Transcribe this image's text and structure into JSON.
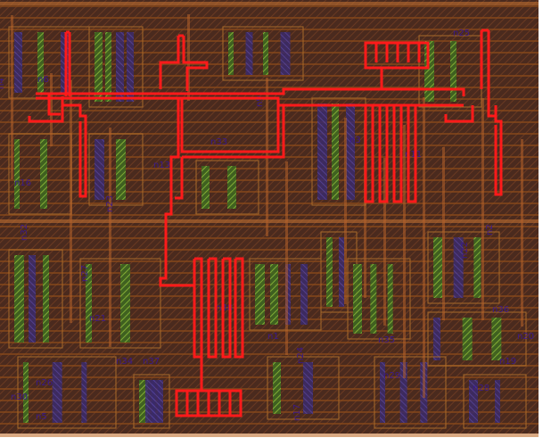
{
  "view": {
    "kind": "ic-layout-viewer",
    "highlighted_net_color": "#ff1a1a",
    "substrate_color": "#4a2a1e",
    "layer_colors": {
      "metal1": "#7a3c14",
      "metal2": "#c8661c",
      "poly": "#d03030",
      "diffusion": "#3c8a28",
      "active": "#9ad23c",
      "via": "#3a2aa0"
    }
  },
  "net_labels": [
    {
      "id": "n6",
      "text": "n6"
    },
    {
      "id": "n33",
      "text": "n33"
    },
    {
      "id": "n4",
      "text": "n4"
    },
    {
      "id": "n13",
      "text": "n13"
    },
    {
      "id": "n9",
      "text": "n9"
    },
    {
      "id": "n23",
      "text": "n23"
    },
    {
      "id": "n3",
      "text": "n3"
    },
    {
      "id": "n32",
      "text": "n32"
    },
    {
      "id": "n25",
      "text": "n25"
    },
    {
      "id": "n2",
      "text": "n2"
    },
    {
      "id": "n27",
      "text": "n27"
    },
    {
      "id": "n21",
      "text": "n21"
    },
    {
      "id": "n22",
      "text": "n22"
    },
    {
      "id": "n38",
      "text": "n38"
    },
    {
      "id": "n34",
      "text": "n34"
    },
    {
      "id": "n24",
      "text": "n24"
    },
    {
      "id": "n1",
      "text": "n1"
    },
    {
      "id": "n30",
      "text": "n30"
    },
    {
      "id": "n36",
      "text": "n36"
    },
    {
      "id": "n16",
      "text": "n16"
    },
    {
      "id": "n20",
      "text": "n20"
    },
    {
      "id": "n37",
      "text": "n37"
    },
    {
      "id": "n5",
      "text": "n5"
    },
    {
      "id": "n11",
      "text": "n11"
    },
    {
      "id": "n35",
      "text": "n35"
    },
    {
      "id": "n29",
      "text": "n29"
    },
    {
      "id": "n28",
      "text": "n28"
    },
    {
      "id": "n19",
      "text": "n19"
    },
    {
      "id": "n17",
      "text": "n17"
    },
    {
      "id": "n26",
      "text": "n26"
    }
  ]
}
